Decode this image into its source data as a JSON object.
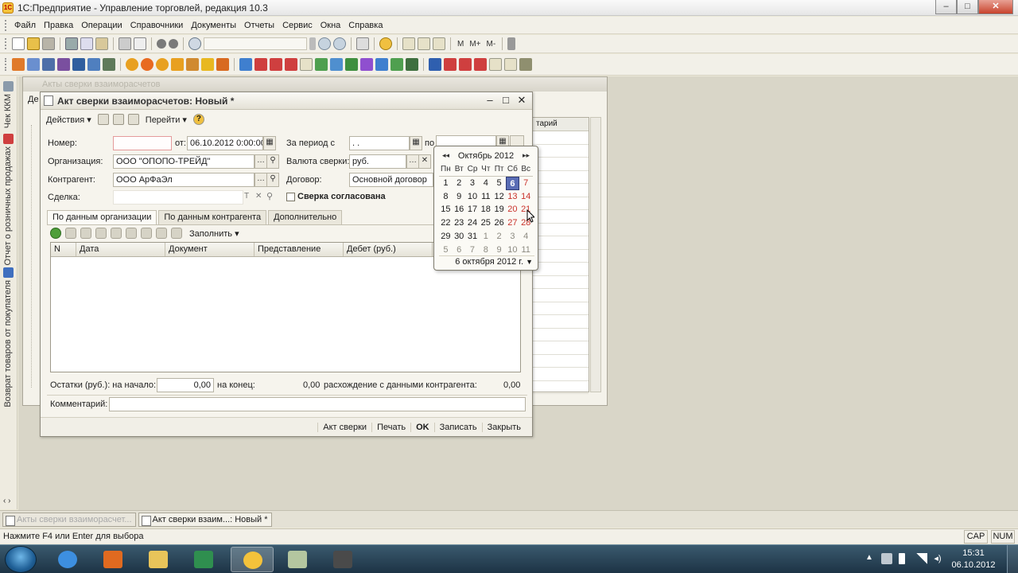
{
  "app": {
    "title": "1С:Предприятие - Управление торговлей, редакция 10.3",
    "icon_label": "1С"
  },
  "window_controls": {
    "minimize": "‒",
    "maximize": "□",
    "close": "✕"
  },
  "menu": [
    "Файл",
    "Правка",
    "Операции",
    "Справочники",
    "Документы",
    "Отчеты",
    "Сервис",
    "Окна",
    "Справка"
  ],
  "toolbar": {
    "m_label": "M",
    "m_plus_label": "M+",
    "m_minus_label": "M-"
  },
  "left_panel": {
    "items": [
      "Чек ККМ",
      "Отчет о розничных продажах",
      "Возврат товаров от покупателя"
    ]
  },
  "background_window": {
    "title": "Акты сверки взаиморасчетов",
    "tab_fragment": "Де",
    "column_header": "тарий"
  },
  "doc": {
    "title": "Акт сверки взаиморасчетов: Новый *",
    "toolbar": {
      "actions": "Действия",
      "goto": "Перейти",
      "help": "?"
    },
    "labels": {
      "number": "Номер:",
      "from": "от:",
      "period": "За период с",
      "by": "по",
      "organization": "Организация:",
      "currency": "Валюта сверки:",
      "counterparty": "Контрагент:",
      "contract": "Договор:",
      "deal": "Сделка:",
      "agreed": "Сверка согласована",
      "balance_start": "Остатки (руб.): на начало:",
      "balance_end": "на конец:",
      "discrepancy": "расхождение с данными контрагента:",
      "comment": "Комментарий:"
    },
    "values": {
      "number": "",
      "date": "06.10.2012  0:00:00",
      "period_from": " .  .",
      "organization": "ООО \"ОПОПО-ТРЕЙД\"",
      "currency": "руб.",
      "counterparty": "ООО АрФаЭл",
      "contract": "Основной договор",
      "deal": "",
      "balance_start": "0,00",
      "balance_end": "0,00",
      "discrepancy": "0,00",
      "comment": ""
    },
    "tabs": [
      "По данным организации",
      "По данным контрагента",
      "Дополнительно"
    ],
    "fill_button": "Заполнить",
    "grid_columns": [
      "N",
      "Дата",
      "Документ",
      "Представление",
      "Дебет (руб.)"
    ],
    "bottom_buttons": [
      "Акт сверки",
      "Печать",
      "OK",
      "Записать",
      "Закрыть"
    ]
  },
  "calendar": {
    "month_year": "Октябрь 2012",
    "weekdays": [
      "Пн",
      "Вт",
      "Ср",
      "Чт",
      "Пт",
      "Сб",
      "Вс"
    ],
    "weeks": [
      [
        "1",
        "2",
        "3",
        "4",
        "5",
        "6",
        "7"
      ],
      [
        "8",
        "9",
        "10",
        "11",
        "12",
        "13",
        "14"
      ],
      [
        "15",
        "16",
        "17",
        "18",
        "19",
        "20",
        "21"
      ],
      [
        "22",
        "23",
        "24",
        "25",
        "26",
        "27",
        "28"
      ],
      [
        "29",
        "30",
        "31",
        "1",
        "2",
        "3",
        "4"
      ],
      [
        "5",
        "6",
        "7",
        "8",
        "9",
        "10",
        "11"
      ]
    ],
    "selected_day": "6",
    "footer": "6 октября 2012 г."
  },
  "window_tabs": [
    "Акты сверки взаиморасчет...",
    "Акт сверки взаим...: Новый *"
  ],
  "status": {
    "hint": "Нажмите F4 или Enter для выбора",
    "cap": "CAP",
    "num": "NUM"
  },
  "taskbar": {
    "time": "15:31",
    "date": "06.10.2012"
  },
  "colors": {
    "accent_selected": "#5a6db5",
    "weekend": "#c9322b",
    "required_field": "#e49b9b"
  }
}
